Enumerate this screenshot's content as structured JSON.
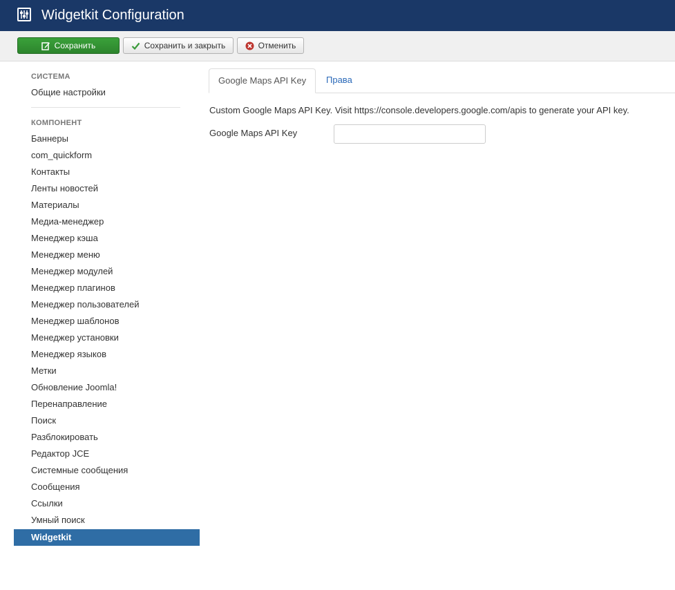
{
  "header": {
    "title": "Widgetkit Configuration",
    "icon": "sliders-icon",
    "background": "#1a3867"
  },
  "toolbar": {
    "save_label": "Сохранить",
    "save_close_label": "Сохранить и закрыть",
    "cancel_label": "Отменить",
    "save_color": "#3aa13a"
  },
  "sidebar": {
    "system_title": "СИСТЕМА",
    "system_items": [
      {
        "label": "Общие настройки"
      }
    ],
    "component_title": "КОМПОНЕНТ",
    "component_items": [
      {
        "label": "Баннеры"
      },
      {
        "label": "com_quickform"
      },
      {
        "label": "Контакты"
      },
      {
        "label": "Ленты новостей"
      },
      {
        "label": "Материалы"
      },
      {
        "label": "Медиа-менеджер"
      },
      {
        "label": "Менеджер кэша"
      },
      {
        "label": "Менеджер меню"
      },
      {
        "label": "Менеджер модулей"
      },
      {
        "label": "Менеджер плагинов"
      },
      {
        "label": "Менеджер пользователей"
      },
      {
        "label": "Менеджер шаблонов"
      },
      {
        "label": "Менеджер установки"
      },
      {
        "label": "Менеджер языков"
      },
      {
        "label": "Метки"
      },
      {
        "label": "Обновление Joomla!"
      },
      {
        "label": "Перенаправление"
      },
      {
        "label": "Поиск"
      },
      {
        "label": "Разблокировать"
      },
      {
        "label": "Редактор JCE"
      },
      {
        "label": "Системные сообщения"
      },
      {
        "label": "Сообщения"
      },
      {
        "label": "Ссылки"
      },
      {
        "label": "Умный поиск"
      },
      {
        "label": "Widgetkit"
      }
    ],
    "active_item": "Widgetkit",
    "active_color": "#2f6da5"
  },
  "tabs": [
    {
      "label": "Google Maps API Key",
      "active": true
    },
    {
      "label": "Права",
      "active": false
    }
  ],
  "main": {
    "description": "Custom Google Maps API Key. Visit https://console.developers.google.com/apis to generate your API key.",
    "field_label": "Google Maps API Key",
    "field_value": ""
  }
}
